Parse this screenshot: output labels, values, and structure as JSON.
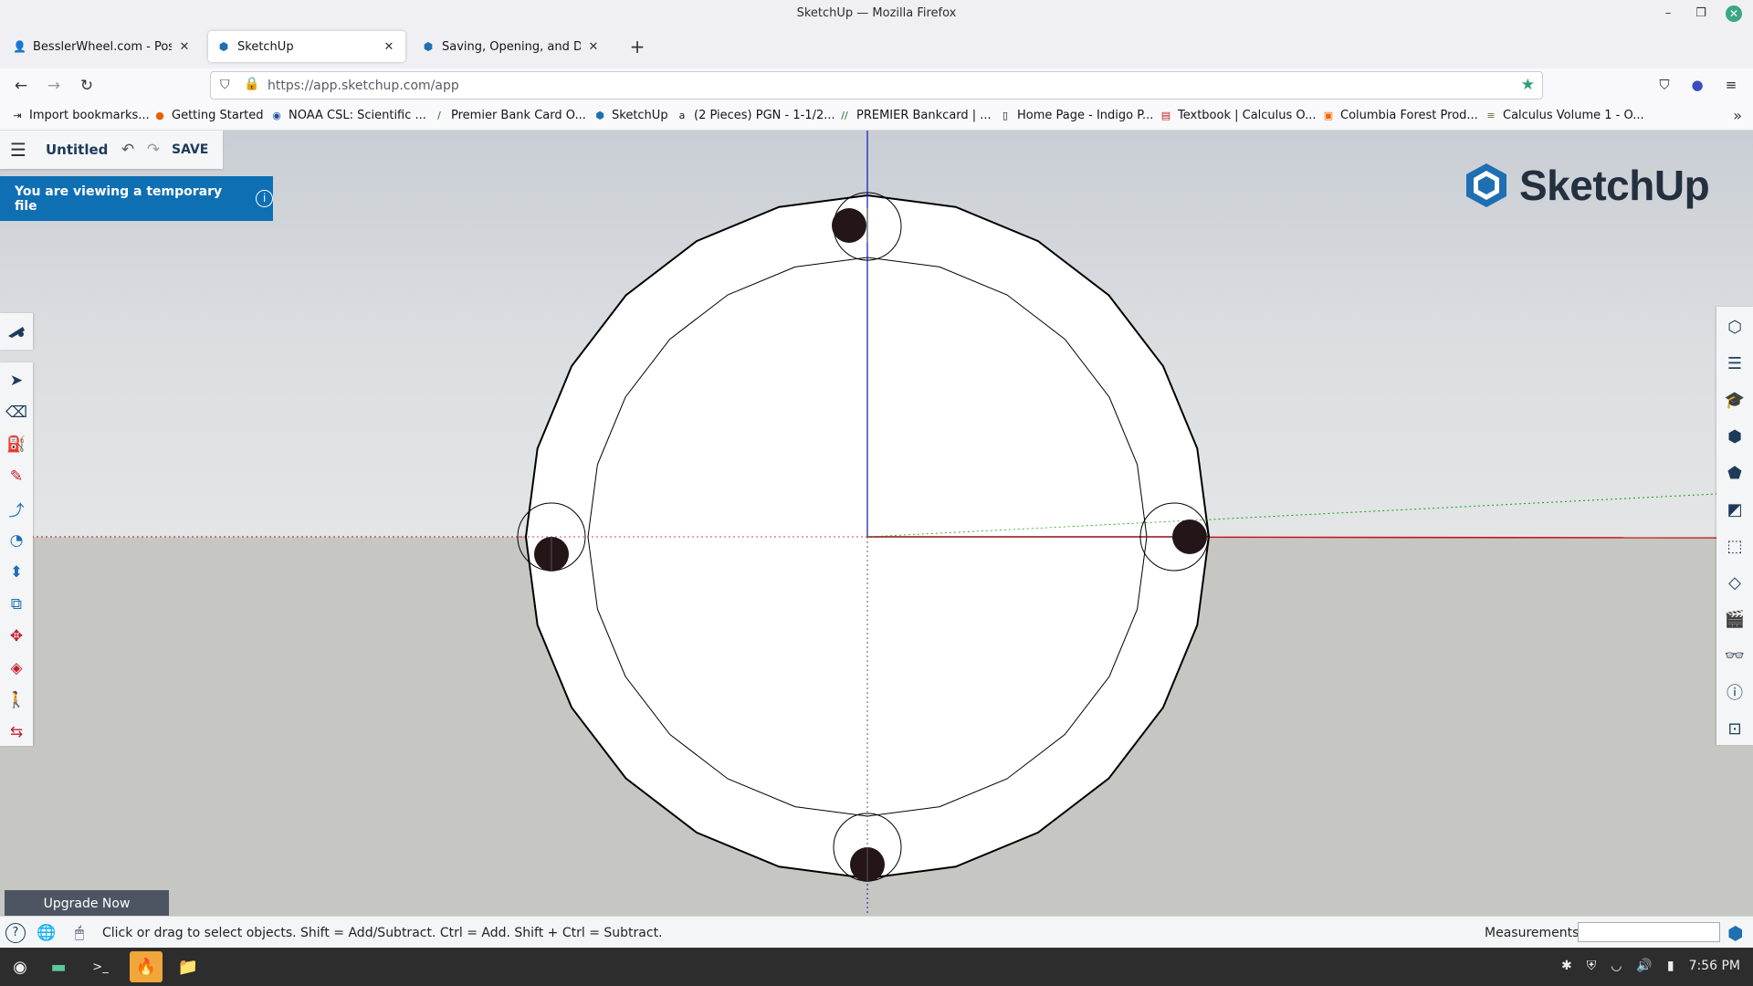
{
  "window": {
    "title": "SketchUp — Mozilla Firefox",
    "minimize": "–",
    "maximize": "❐",
    "close": "✕"
  },
  "tabs": [
    {
      "label": "BesslerWheel.com - Post a r",
      "icon": "forum-icon",
      "close": "✕"
    },
    {
      "label": "SketchUp",
      "icon": "sketchup-icon",
      "close": "✕"
    },
    {
      "label": "Saving, Opening, and Downl",
      "icon": "sketchup-icon",
      "close": "✕"
    }
  ],
  "new_tab": "+",
  "nav": {
    "back": "←",
    "forward": "→",
    "reload": "↻",
    "url": "https://app.sketchup.com/app",
    "pocket": "⛉",
    "account": "●",
    "menu": "≡"
  },
  "bookmarks": [
    {
      "label": "Import bookmarks...",
      "icon": "import-icon"
    },
    {
      "label": "Getting Started",
      "icon": "firefox-icon"
    },
    {
      "label": "NOAA CSL: Scientific ...",
      "icon": "noaa-icon"
    },
    {
      "label": "Premier Bank Card O...",
      "icon": "premier-icon"
    },
    {
      "label": "SketchUp",
      "icon": "sketchup-icon"
    },
    {
      "label": "(2 Pieces) PGN - 1-1/2...",
      "icon": "amazon-icon"
    },
    {
      "label": "PREMIER Bankcard | ...",
      "icon": "premier-icon"
    },
    {
      "label": "Home Page - Indigo P...",
      "icon": "page-icon"
    },
    {
      "label": "Textbook | Calculus O...",
      "icon": "textbook-icon"
    },
    {
      "label": "Columbia Forest Prod...",
      "icon": "homedepot-icon"
    },
    {
      "label": "Calculus Volume 1 - O...",
      "icon": "openstax-icon"
    }
  ],
  "bookmarks_more": "»",
  "app": {
    "file_name": "Untitled",
    "save": "SAVE",
    "temp_notice": "You are viewing a temporary file",
    "info": "i",
    "logo_text": "SketchUp",
    "upgrade": "Upgrade Now",
    "status_text": "Click or drag to select objects. Shift = Add/Subtract. Ctrl = Add. Shift + Ctrl = Subtract.",
    "measurements_label": "Measurements",
    "measurements_value": ""
  },
  "left_tools": [
    {
      "name": "search-tool-icon",
      "glyph": "🔭"
    },
    {
      "name": "select-tool-icon",
      "glyph": "➤"
    },
    {
      "name": "eraser-tool-icon",
      "glyph": "⌫"
    },
    {
      "name": "paint-bucket-tool-icon",
      "glyph": "⛽"
    },
    {
      "name": "pencil-line-tool-icon",
      "glyph": "✎"
    },
    {
      "name": "arc-tool-icon",
      "glyph": "⤴"
    },
    {
      "name": "shapes-tool-icon",
      "glyph": "◔"
    },
    {
      "name": "push-pull-tool-icon",
      "glyph": "⬍"
    },
    {
      "name": "offset-tool-icon",
      "glyph": "⧉"
    },
    {
      "name": "move-tool-icon",
      "glyph": "✥"
    },
    {
      "name": "tape-measure-tool-icon",
      "glyph": "◈"
    },
    {
      "name": "walk-tool-icon",
      "glyph": "🚶"
    },
    {
      "name": "section-plane-tool-icon",
      "glyph": "⇆"
    }
  ],
  "right_tools": [
    {
      "name": "entity-info-panel-icon",
      "glyph": "⬡"
    },
    {
      "name": "outliner-panel-icon",
      "glyph": "☰"
    },
    {
      "name": "instructor-panel-icon",
      "glyph": "🎓"
    },
    {
      "name": "components-panel-icon",
      "glyph": "⬢"
    },
    {
      "name": "materials-panel-icon",
      "glyph": "⬟"
    },
    {
      "name": "styles-panel-icon",
      "glyph": "◩"
    },
    {
      "name": "tags-panel-icon",
      "glyph": "⬚"
    },
    {
      "name": "scenes-panel-icon",
      "glyph": "◇"
    },
    {
      "name": "display-panel-icon",
      "glyph": "🎬"
    },
    {
      "name": "view-panel-icon",
      "glyph": "👓"
    },
    {
      "name": "model-info-panel-icon",
      "glyph": "ⓘ"
    },
    {
      "name": "extension-panel-icon",
      "glyph": "⊡"
    }
  ],
  "status_icons": {
    "help": "?",
    "globe": "🌐",
    "mouse": "🖱"
  },
  "taskbar": {
    "menu": "◉",
    "files": "▬",
    "terminal": ">_",
    "firefox": "🔥",
    "folder": "📁",
    "time": "7:56 PM",
    "tray": [
      "✱",
      "⛨",
      "◡",
      "🔊",
      "▮"
    ]
  },
  "colors": {
    "axis_blue": "#1010c0",
    "axis_red": "#c01010",
    "axis_green": "#10a010",
    "banner_blue": "#0f6fb3",
    "sketchup_navy": "#24303f"
  }
}
